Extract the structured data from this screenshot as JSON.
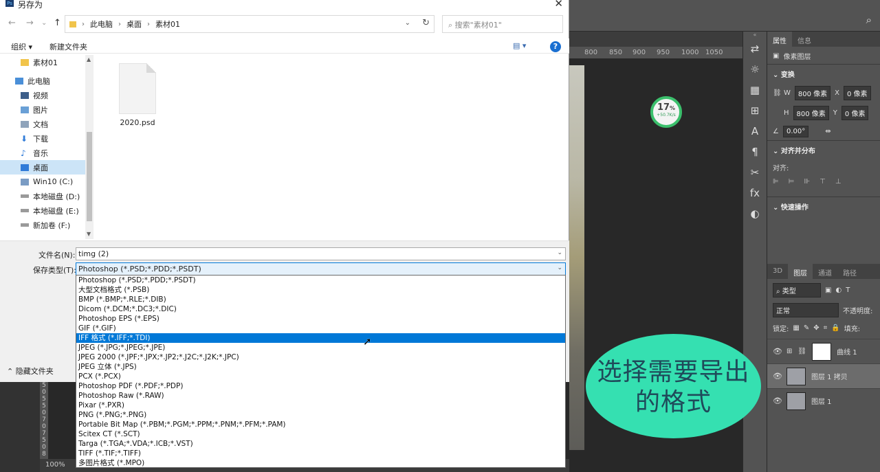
{
  "dialog": {
    "title": "另存为",
    "close_glyph": "✕",
    "nav": {
      "back": "←",
      "forward": "→",
      "recent": "⌄",
      "up": "↑"
    },
    "breadcrumb": [
      "此电脑",
      "桌面",
      "素材01"
    ],
    "breadcrumb_sep": "›",
    "search_placeholder": "搜索\"素材01\"",
    "toolbar": {
      "organize": "组织 ▾",
      "new_folder": "新建文件夹",
      "view": "▤ ▾",
      "help": "?"
    },
    "tree": [
      {
        "label": "素材01",
        "icon": "folder-icon"
      },
      {
        "label": "此电脑",
        "icon": "computer-icon"
      },
      {
        "label": "视频",
        "icon": "video-folder-icon"
      },
      {
        "label": "图片",
        "icon": "pictures-folder-icon"
      },
      {
        "label": "文档",
        "icon": "documents-folder-icon"
      },
      {
        "label": "下载",
        "icon": "download-icon"
      },
      {
        "label": "音乐",
        "icon": "music-icon"
      },
      {
        "label": "桌面",
        "icon": "desktop-icon"
      },
      {
        "label": "Win10 (C:)",
        "icon": "system-drive-icon"
      },
      {
        "label": "本地磁盘 (D:)",
        "icon": "drive-icon"
      },
      {
        "label": "本地磁盘 (E:)",
        "icon": "drive-icon"
      },
      {
        "label": "新加卷 (F:)",
        "icon": "drive-icon"
      }
    ],
    "files": [
      {
        "name": "2020.psd"
      }
    ],
    "filename_label": "文件名(N):",
    "filename_value": "timg (2)",
    "savetype_label": "保存类型(T):",
    "savetype_value": "Photoshop (*.PSD;*.PDD;*.PSDT)",
    "hide_folders": "隐藏文件夹",
    "format_options": [
      "Photoshop (*.PSD;*.PDD;*.PSDT)",
      "大型文档格式 (*.PSB)",
      "BMP (*.BMP;*.RLE;*.DIB)",
      "Dicom (*.DCM;*.DC3;*.DIC)",
      "Photoshop EPS (*.EPS)",
      "GIF (*.GIF)",
      "IFF 格式 (*.IFF;*.TDI)",
      "JPEG (*.JPG;*.JPEG;*.JPE)",
      "JPEG 2000 (*.JPF;*.JPX;*.JP2;*.J2C;*.J2K;*.JPC)",
      "JPEG 立体 (*.JPS)",
      "PCX (*.PCX)",
      "Photoshop PDF (*.PDF;*.PDP)",
      "Photoshop Raw (*.RAW)",
      "Pixar (*.PXR)",
      "PNG (*.PNG;*.PNG)",
      "Portable Bit Map (*.PBM;*.PGM;*.PPM;*.PNM;*.PFM;*.PAM)",
      "Scitex CT (*.SCT)",
      "Targa (*.TGA;*.VDA;*.ICB;*.VST)",
      "TIFF (*.TIF;*.TIFF)",
      "多图片格式 (*.MPO)"
    ],
    "highlighted_index": 6
  },
  "photoshop": {
    "ruler_ticks": [
      "800",
      "850",
      "900",
      "950",
      "1000",
      "1050"
    ],
    "zoom": "100%",
    "left_ruler": [
      "5",
      "0",
      "5",
      "5",
      "0",
      "7",
      "0",
      "7",
      "5",
      "0",
      "8"
    ],
    "progress": {
      "percent": "17",
      "unit": "%",
      "speed": "+50.7K/s"
    },
    "tools": [
      "⇄",
      "☼",
      "▦",
      "⊞",
      "A",
      "¶",
      "✂",
      "fx",
      "◐"
    ],
    "props_tabs": [
      "属性",
      "信息"
    ],
    "pixel_layer": "像素图层",
    "transform_title": "变换",
    "w_label": "W",
    "w_value": "800 像素",
    "x_label": "X",
    "x_value": "0 像素",
    "h_label": "H",
    "h_value": "800 像素",
    "y_label": "Y",
    "y_value": "0 像素",
    "angle_value": "0.00°",
    "align_title": "对齐并分布",
    "align_label": "对齐:",
    "quick_title": "快速操作",
    "layer_tabs": [
      "3D",
      "图层",
      "通道",
      "路径"
    ],
    "layer_filter": "类型",
    "blend_mode": "正常",
    "opacity_label": "不透明度:",
    "lock_label": "锁定:",
    "fill_label": "填充:",
    "layers": [
      {
        "name": "曲线 1"
      },
      {
        "name": "图层 1 拷贝"
      },
      {
        "name": "图层 1"
      }
    ]
  },
  "annotation": {
    "line1": "选择需要导出",
    "line2": "的格式"
  },
  "colors": {
    "highlight": "#0078d7",
    "bubble": "#35e0b1",
    "ps_panel": "#535353"
  }
}
